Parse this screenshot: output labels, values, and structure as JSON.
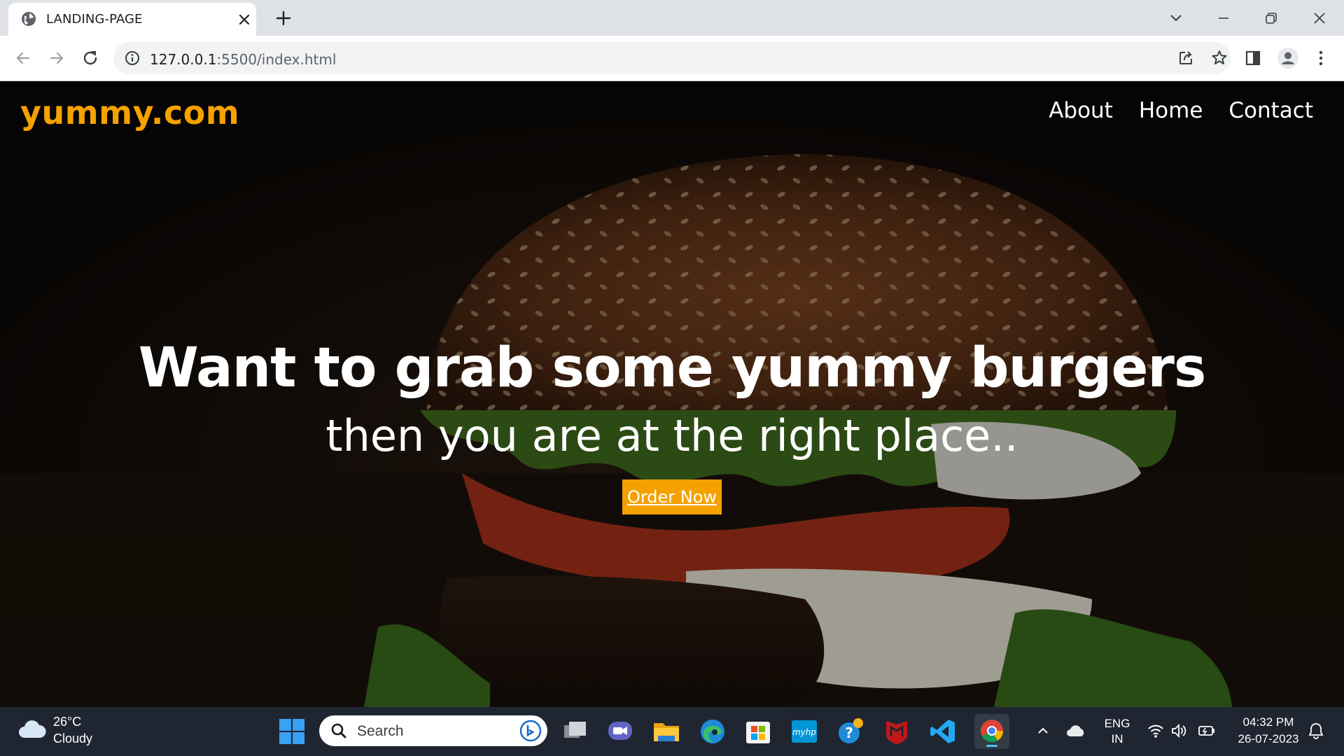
{
  "browser": {
    "tab_title": "LANDING-PAGE",
    "url_host": "127.0.0.1",
    "url_path": ":5500/index.html"
  },
  "page": {
    "brand": "yummy.com",
    "nav": [
      "About",
      "Home",
      "Contact"
    ],
    "headline": "Want to grab some yummy burgers",
    "subheadline": "then you are at the right place..",
    "cta": "Order Now",
    "accent_color": "#f5a100"
  },
  "taskbar": {
    "weather_temp": "26°C",
    "weather_desc": "Cloudy",
    "search_placeholder": "Search",
    "language": "ENG",
    "region": "IN",
    "time": "04:32 PM",
    "date": "26-07-2023"
  }
}
